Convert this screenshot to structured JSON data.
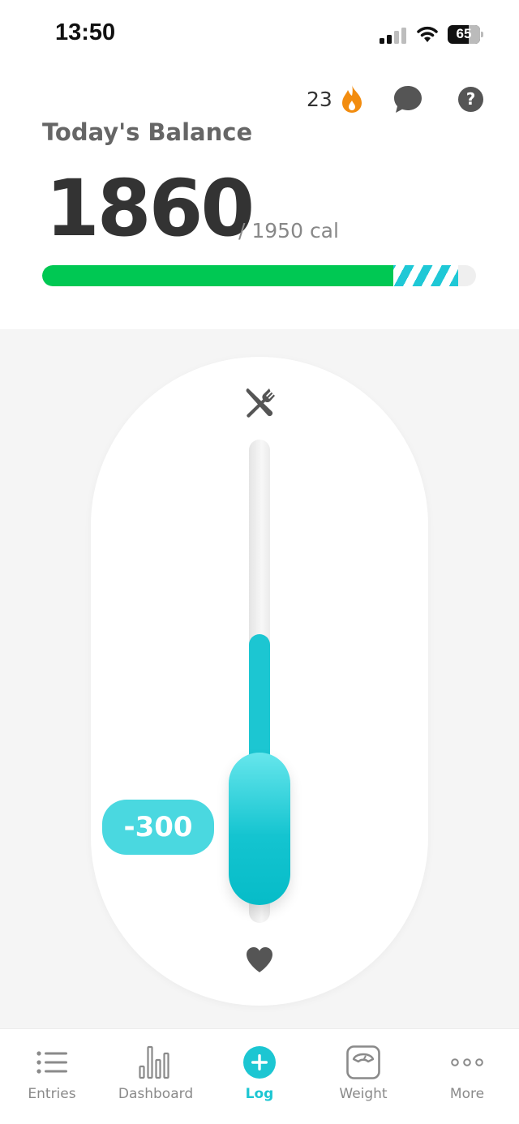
{
  "status_bar": {
    "time": "13:50",
    "battery": "65",
    "battery_level": 0.65,
    "icons": [
      "signal-icon",
      "wifi-icon",
      "battery-icon"
    ]
  },
  "header": {
    "streak_count": "23",
    "streak_icon": "flame-icon",
    "chat_icon": "chat-icon",
    "help_icon": "help-icon",
    "help_glyph": "?",
    "balance_label": "Today's Balance",
    "balance_value": "1860",
    "balance_goal": "/ 1950 cal",
    "progress": {
      "consumed_fraction": 0.81,
      "striped_fraction": 0.15
    }
  },
  "slider": {
    "top_icon": "fork-knife-icon",
    "bottom_icon": "heart-icon",
    "value_label": "-300",
    "fill_fraction": 0.5
  },
  "colors": {
    "accent": "#1cc6d2",
    "progress_green": "#00c853",
    "flame": "#f28c0f"
  },
  "nav": {
    "items": [
      {
        "label": "Entries",
        "icon": "list-icon",
        "active": false
      },
      {
        "label": "Dashboard",
        "icon": "bar-chart-icon",
        "active": false
      },
      {
        "label": "Log",
        "icon": "plus-circle-icon",
        "active": true
      },
      {
        "label": "Weight",
        "icon": "scale-icon",
        "active": false
      },
      {
        "label": "More",
        "icon": "more-dots-icon",
        "active": false
      }
    ]
  }
}
